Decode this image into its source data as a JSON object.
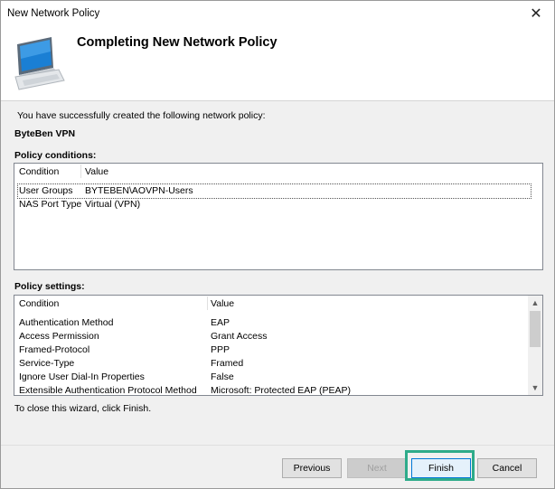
{
  "window": {
    "title": "New Network Policy",
    "close_glyph": "✕"
  },
  "header": {
    "title": "Completing New Network Policy",
    "icon": "computer-monitor-icon"
  },
  "intro_text": "You have successfully created the following network policy:",
  "policy_name": "ByteBen VPN",
  "conditions": {
    "label": "Policy conditions:",
    "columns": [
      "Condition",
      "Value"
    ],
    "rows": [
      {
        "condition": "User Groups",
        "value": "BYTEBEN\\AOVPN-Users"
      },
      {
        "condition": "NAS Port Type",
        "value": "Virtual (VPN)"
      }
    ]
  },
  "settings": {
    "label": "Policy settings:",
    "columns": [
      "Condition",
      "Value"
    ],
    "rows": [
      {
        "condition": "Authentication Method",
        "value": "EAP"
      },
      {
        "condition": "Access Permission",
        "value": "Grant Access"
      },
      {
        "condition": "Framed-Protocol",
        "value": "PPP"
      },
      {
        "condition": "Service-Type",
        "value": "Framed"
      },
      {
        "condition": "Ignore User Dial-In Properties",
        "value": "False"
      },
      {
        "condition": "Extensible Authentication Protocol Method",
        "value": "Microsoft: Protected EAP (PEAP)"
      }
    ]
  },
  "close_hint": "To close this wizard, click Finish.",
  "buttons": {
    "previous": "Previous",
    "next": "Next",
    "finish": "Finish",
    "cancel": "Cancel"
  },
  "colors": {
    "highlight": "#2eab8a",
    "focus": "#0078d7"
  }
}
